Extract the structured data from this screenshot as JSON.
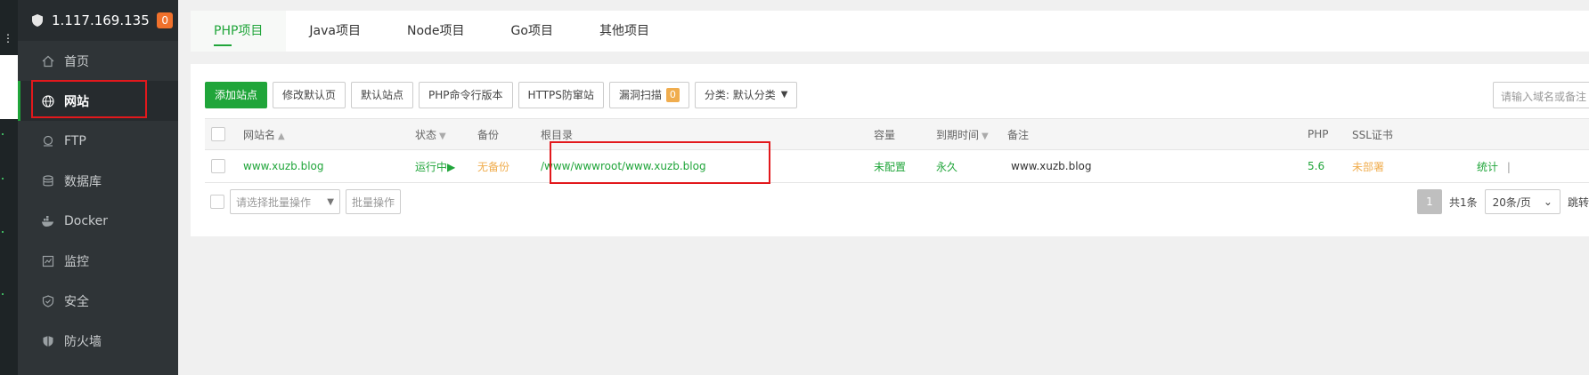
{
  "sidebar": {
    "server_ip": "1.117.169.135",
    "badge": "0",
    "items": [
      {
        "label": "首页",
        "icon": "home-icon"
      },
      {
        "label": "网站",
        "icon": "globe-icon"
      },
      {
        "label": "FTP",
        "icon": "ftp-icon"
      },
      {
        "label": "数据库",
        "icon": "database-icon"
      },
      {
        "label": "Docker",
        "icon": "docker-icon"
      },
      {
        "label": "监控",
        "icon": "monitor-icon"
      },
      {
        "label": "安全",
        "icon": "shield-check-icon"
      },
      {
        "label": "防火墙",
        "icon": "firewall-icon"
      }
    ]
  },
  "tabs": [
    "PHP项目",
    "Java项目",
    "Node项目",
    "Go项目",
    "其他项目"
  ],
  "toolbar": {
    "add_site": "添加站点",
    "modify_default_page": "修改默认页",
    "default_site": "默认站点",
    "php_cli_version": "PHP命令行版本",
    "https_guard": "HTTPS防窜站",
    "vuln_scan": "漏洞扫描",
    "vuln_count": "0",
    "category": "分类: 默认分类"
  },
  "search": {
    "placeholder": "请输入域名或备注"
  },
  "table": {
    "headers": {
      "name": "网站名",
      "status": "状态",
      "backup": "备份",
      "root": "根目录",
      "capacity": "容量",
      "expire": "到期时间",
      "remark": "备注",
      "php": "PHP",
      "ssl": "SSL证书"
    },
    "rows": [
      {
        "name": "www.xuzb.blog",
        "status": "运行中▶",
        "backup": "无备份",
        "root": "/www/wwwroot/www.xuzb.blog",
        "capacity": "未配置",
        "expire": "永久",
        "remark": "www.xuzb.blog",
        "php": "5.6",
        "ssl": "未部署",
        "action": "统计",
        "separator": "|"
      }
    ]
  },
  "batch": {
    "placeholder": "请选择批量操作",
    "button": "批量操作"
  },
  "pager": {
    "current": "1",
    "total": "共1条",
    "per_page": "20条/页",
    "jump": "跳转"
  },
  "colors": {
    "accent": "#20a53a",
    "warning": "#f0ad4e",
    "highlight": "#e2181c",
    "sidebar_bg": "#2f3437"
  }
}
